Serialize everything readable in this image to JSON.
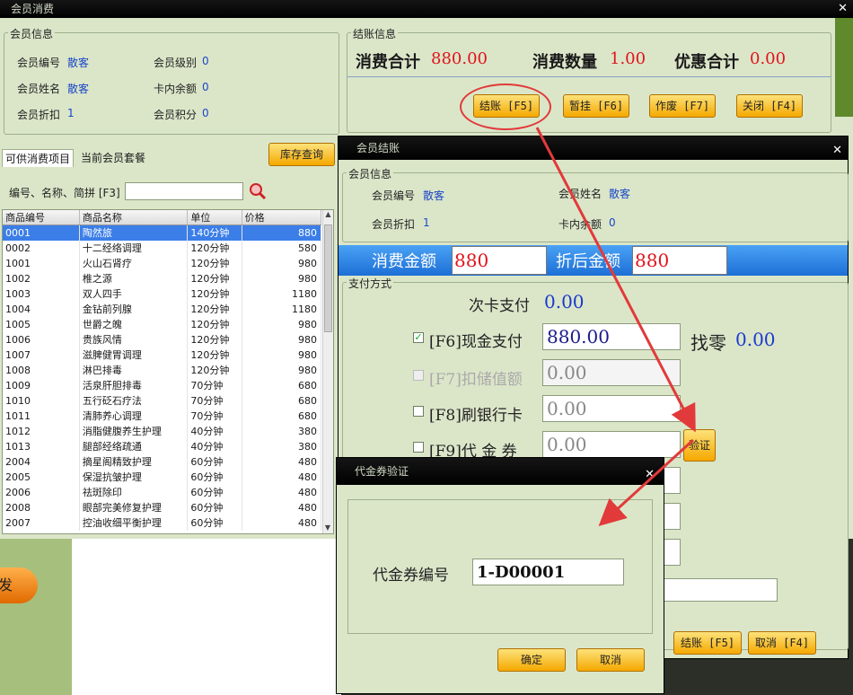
{
  "main_window": {
    "title": "会员消费",
    "member_info": {
      "section_title": "会员信息",
      "id_label": "会员编号",
      "id_value": "散客",
      "level_label": "会员级别",
      "level_value": "0",
      "name_label": "会员姓名",
      "name_value": "散客",
      "balance_label": "卡内余额",
      "balance_value": "0",
      "discount_label": "会员折扣",
      "discount_value": "1",
      "points_label": "会员积分",
      "points_value": "0"
    },
    "checkout_info": {
      "section_title": "结账信息",
      "total_label": "消费合计",
      "total_value": "880.00",
      "qty_label": "消费数量",
      "qty_value": "1.00",
      "discount_total_label": "优惠合计",
      "discount_total_value": "0.00",
      "buttons": {
        "checkout": "结账 [F5]",
        "hold": "暂挂 [F6]",
        "void": "作废 [F7]",
        "close": "关闭 [F4]"
      }
    },
    "tabs": {
      "available": "可供消费项目",
      "packages": "当前会员套餐"
    },
    "stock_button": "库存查询",
    "search_label": "编号、名称、简拼 [F3]",
    "search_value": "",
    "table": {
      "headers": [
        "商品编号",
        "商品名称",
        "单位",
        "价格"
      ],
      "rows": [
        [
          "0001",
          "陶然旅",
          "140分钟",
          "880"
        ],
        [
          "0002",
          "十二经络调理",
          "120分钟",
          "580"
        ],
        [
          "1001",
          "火山石肾疗",
          "120分钟",
          "980"
        ],
        [
          "1002",
          "椎之源",
          "120分钟",
          "980"
        ],
        [
          "1003",
          "双人四手",
          "120分钟",
          "1180"
        ],
        [
          "1004",
          "金钻前列腺",
          "120分钟",
          "1180"
        ],
        [
          "1005",
          "世爵之魄",
          "120分钟",
          "980"
        ],
        [
          "1006",
          "贵族风情",
          "120分钟",
          "980"
        ],
        [
          "1007",
          "滋脾健胃调理",
          "120分钟",
          "980"
        ],
        [
          "1008",
          "淋巴排毒",
          "120分钟",
          "980"
        ],
        [
          "1009",
          "活泉肝胆排毒",
          "70分钟",
          "680"
        ],
        [
          "1010",
          "五行砭石疗法",
          "70分钟",
          "680"
        ],
        [
          "1011",
          "清肺养心调理",
          "70分钟",
          "680"
        ],
        [
          "1012",
          "消脂健腹养生护理",
          "40分钟",
          "380"
        ],
        [
          "1013",
          "腿部经络疏通",
          "40分钟",
          "380"
        ],
        [
          "2004",
          "摘星阁精致护理",
          "60分钟",
          "480"
        ],
        [
          "2005",
          "保湿抗皱护理",
          "60分钟",
          "480"
        ],
        [
          "2006",
          "祛斑除印",
          "60分钟",
          "480"
        ],
        [
          "2008",
          "眼部完美修复护理",
          "60分钟",
          "480"
        ],
        [
          "2007",
          "控油收细平衡护理",
          "60分钟",
          "480"
        ]
      ]
    },
    "side_button": "发"
  },
  "checkout_window": {
    "title": "会员结账",
    "member_info": {
      "section_title": "会员信息",
      "id_label": "会员编号",
      "id_value": "散客",
      "name_label": "会员姓名",
      "name_value": "散客",
      "discount_label": "会员折扣",
      "discount_value": "1",
      "balance_label": "卡内余额",
      "balance_value": "0"
    },
    "amount_label": "消费金额",
    "amount_value": "880",
    "after_discount_label": "折后金额",
    "after_discount_value": "880",
    "payment": {
      "section_title": "支付方式",
      "times_card_label": "次卡支付",
      "times_card_value": "0.00",
      "cash_label": "[F6]现金支付",
      "cash_value": "880.00",
      "cash_checked": true,
      "change_label": "找零",
      "change_value": "0.00",
      "stored_label": "[F7]扣储值额",
      "stored_value": "0.00",
      "bank_label": "[F8]刷银行卡",
      "bank_value": "0.00",
      "voucher_label": "[F9]代 金 券",
      "voucher_value": "0.00",
      "verify_button": "验证"
    },
    "buttons": {
      "checkout": "结账 [F5]",
      "cancel": "取消 [F4]"
    }
  },
  "voucher_dialog": {
    "title": "代金券验证",
    "code_label": "代金券编号",
    "code_value": "1-D00001",
    "confirm": "确定",
    "cancel": "取消"
  },
  "colors": {
    "panel": "#dbe6c9",
    "accent_blue": "#3b7ee8",
    "highlight_red": "#e0141c",
    "button_orange": "#f5a800"
  }
}
